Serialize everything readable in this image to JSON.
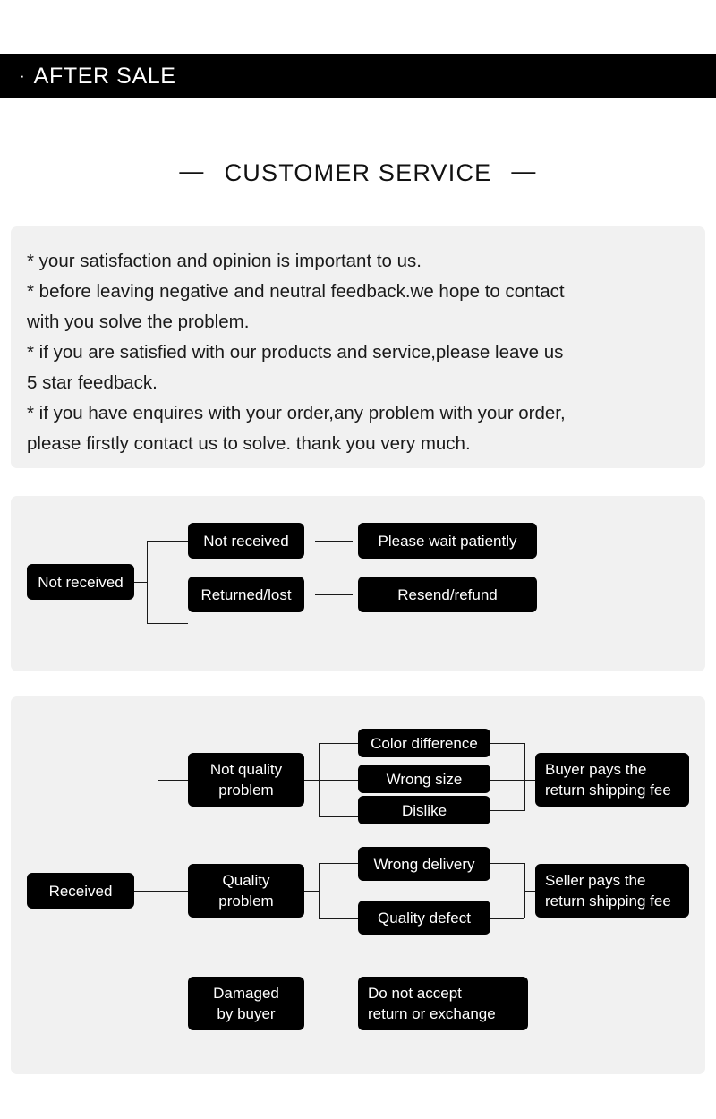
{
  "banner": {
    "bullet": "·",
    "title": "AFTER SALE"
  },
  "heading": {
    "dash_left": "—",
    "text": "CUSTOMER SERVICE",
    "dash_right": "—"
  },
  "policy": {
    "lines": [
      "* your satisfaction and opinion is important to us.",
      "* before leaving negative and neutral feedback.we hope to contact",
      "with you solve the problem.",
      "* if you are satisfied with our products and service,please leave us",
      "5 star feedback.",
      "* if you have enquires with your order,any problem with your order,",
      "please firstly contact us to solve. thank you very much."
    ]
  },
  "flow_not_received": {
    "root": "Not received",
    "branches": [
      {
        "cause": "Not received",
        "outcome": "Please wait patiently"
      },
      {
        "cause": "Returned/lost",
        "outcome": "Resend/refund"
      }
    ]
  },
  "flow_received": {
    "root": "Received",
    "groups": [
      {
        "category": "Not quality\nproblem",
        "reasons": [
          "Color difference",
          "Wrong size",
          "Dislike"
        ],
        "outcome": "Buyer pays the\nreturn shipping fee"
      },
      {
        "category": "Quality\nproblem",
        "reasons": [
          "Wrong delivery",
          "Quality defect"
        ],
        "outcome": "Seller pays the\nreturn shipping fee"
      },
      {
        "category": "Damaged\nby buyer",
        "reasons": [],
        "outcome": "Do not accept\nreturn or exchange"
      }
    ]
  },
  "colors": {
    "banner_background": "#000000",
    "banner_text": "#ffffff",
    "panel_background": "#f1f1f1",
    "node_background": "#000000",
    "node_text": "#ffffff",
    "page_background": "#ffffff",
    "connector": "#1a1a1a"
  }
}
